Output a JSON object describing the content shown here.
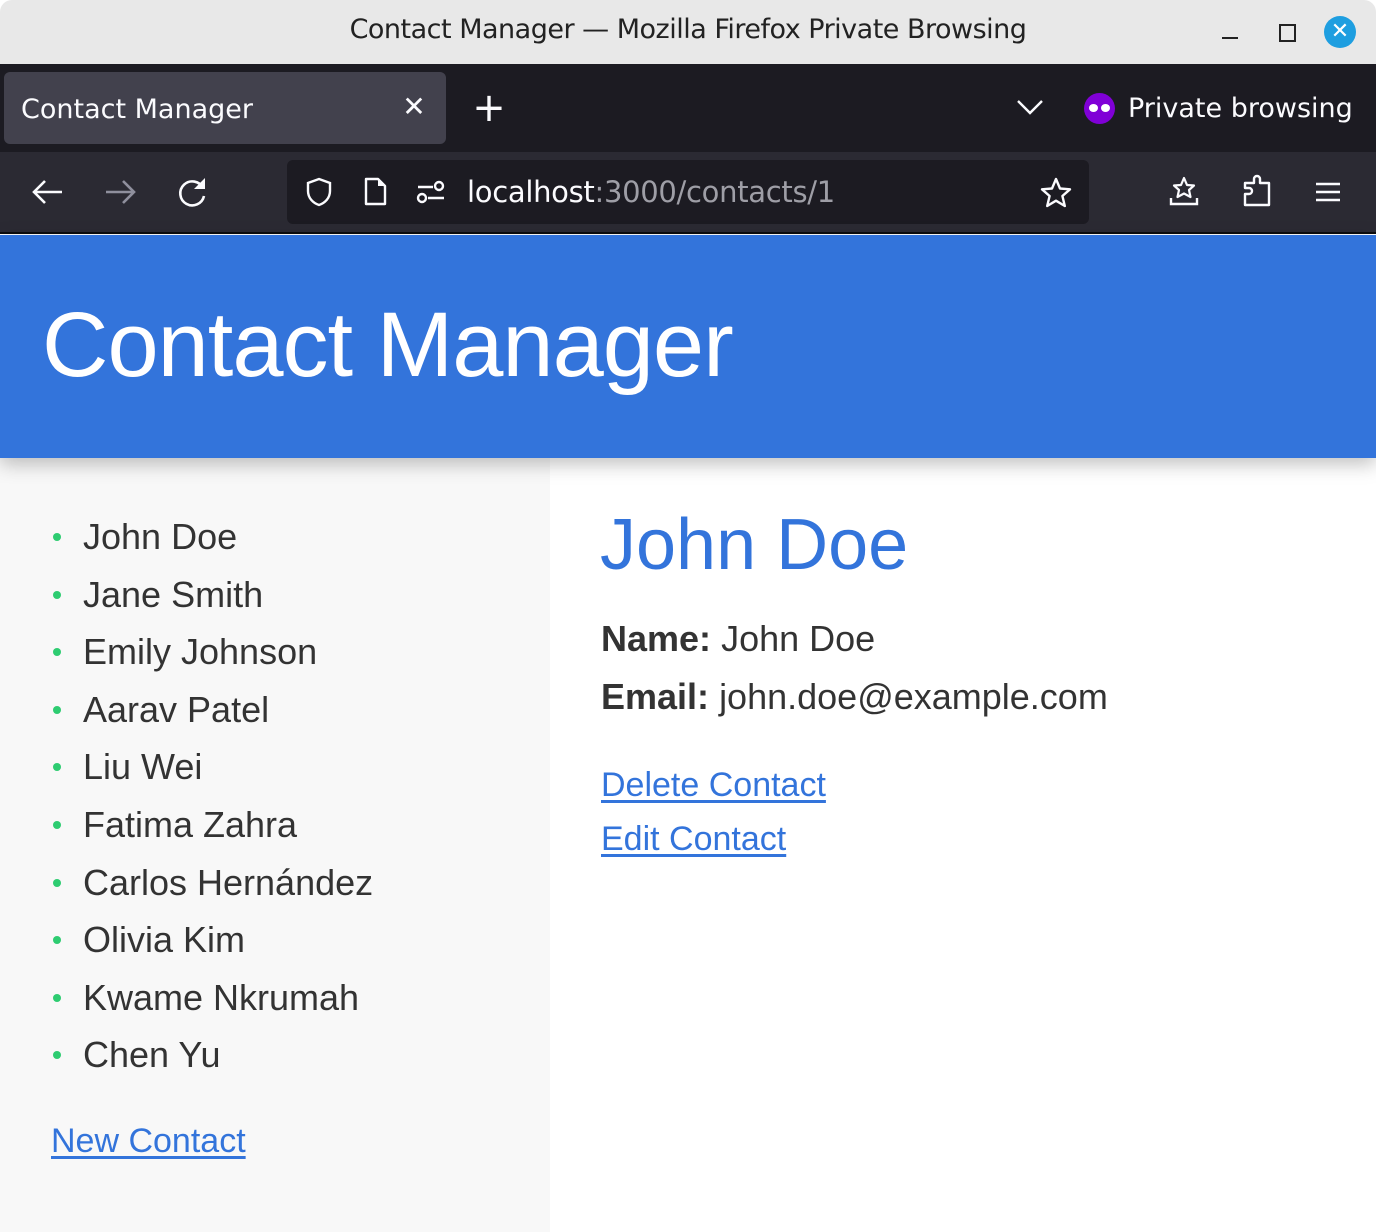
{
  "window": {
    "title": "Contact Manager — Mozilla Firefox Private Browsing"
  },
  "browser": {
    "tabs": [
      {
        "label": "Contact Manager",
        "active": true
      }
    ],
    "private_label": "Private browsing",
    "url": {
      "host": "localhost",
      "rest": ":3000/contacts/1"
    },
    "colors": {
      "private_accent": "#8000d7"
    }
  },
  "app": {
    "header_title": "Contact Manager",
    "brand_color": "#3374db",
    "bullet_color": "#2ecc71",
    "contacts": [
      "John Doe",
      "Jane Smith",
      "Emily Johnson",
      "Aarav Patel",
      "Liu Wei",
      "Fatima Zahra",
      "Carlos Hernández",
      "Olivia Kim",
      "Kwame Nkrumah",
      "Chen Yu"
    ],
    "new_contact_label": "New Contact",
    "detail": {
      "heading": "John Doe",
      "name_label": "Name:",
      "name_value": "John Doe",
      "email_label": "Email:",
      "email_value": "john.doe@example.com",
      "delete_label": "Delete Contact",
      "edit_label": "Edit Contact"
    }
  }
}
